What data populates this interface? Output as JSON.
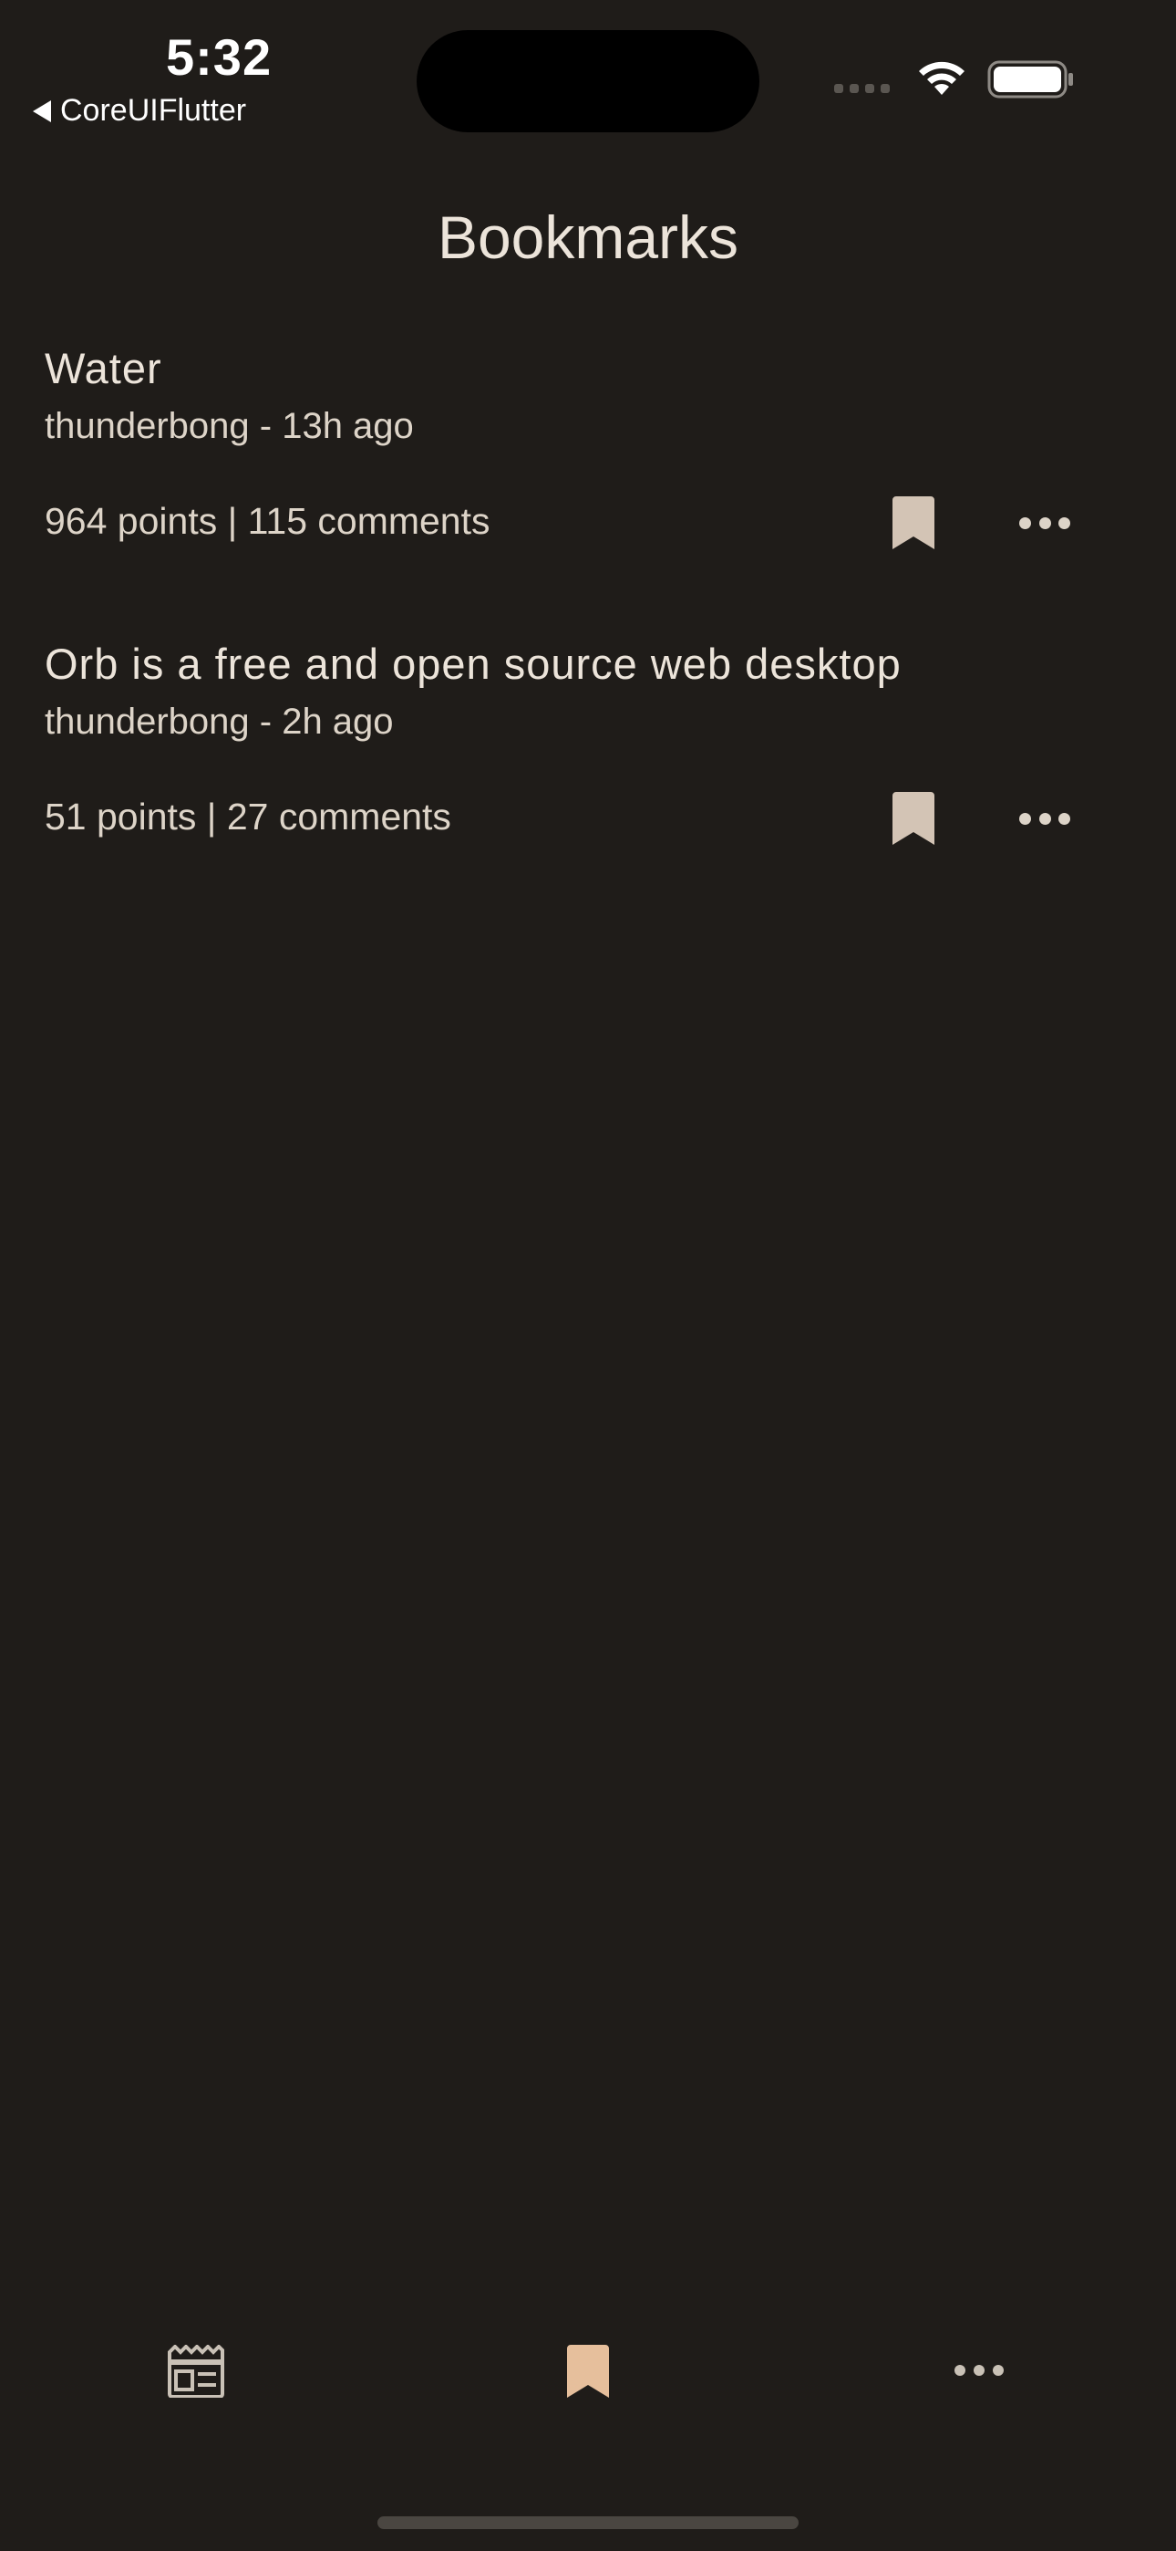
{
  "status_bar": {
    "time": "5:32",
    "back_app": "CoreUIFlutter",
    "signal_icon": "cellular-signal-icon",
    "wifi_icon": "wifi-icon",
    "battery_icon": "battery-icon"
  },
  "header": {
    "title": "Bookmarks"
  },
  "stories": [
    {
      "title": "Water",
      "meta": "thunderbong - 13h ago",
      "stats": "964 points | 115 comments",
      "bookmark_icon": "bookmark-icon",
      "more_icon": "more-icon"
    },
    {
      "title": "Orb is a free and open source web desktop",
      "meta": "thunderbong - 2h ago",
      "stats": "51 points | 27 comments",
      "bookmark_icon": "bookmark-icon",
      "more_icon": "more-icon"
    }
  ],
  "tab_bar": {
    "tabs": [
      {
        "icon": "newspaper-icon",
        "active": false
      },
      {
        "icon": "bookmark-icon",
        "active": true
      },
      {
        "icon": "more-icon",
        "active": false
      }
    ]
  },
  "colors": {
    "background": "#1f1c19",
    "text_primary": "#ece4da",
    "text_secondary": "#ddd4c8",
    "bookmark_inactive": "#d3c4b5",
    "tab_active": "#e6bf9c",
    "tab_inactive": "#c9c1b6"
  }
}
